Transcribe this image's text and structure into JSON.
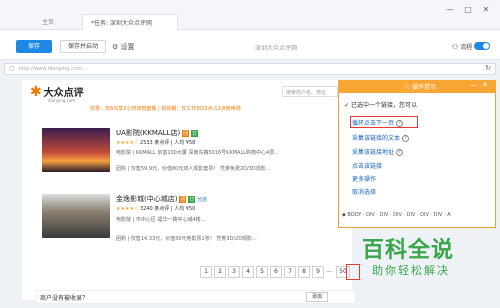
{
  "titlebar": {
    "tabs": [
      {
        "label": "主页"
      },
      {
        "label": "*任务: 深圳大众点评网"
      }
    ],
    "window_controls": [
      "—",
      "□",
      "✕"
    ]
  },
  "toolbar": {
    "save_label": "保存",
    "save_start_label": "保存并启动",
    "settings_label": "设置",
    "task_title": "深圳大众点评网",
    "flow_label": "流程"
  },
  "address_bar": {
    "value": "http://www.dianping.com..."
  },
  "site": {
    "logo_text": "大众点评",
    "logo_url": "dianping.com",
    "search_placeholder": "搜索商户名、地址",
    "top_promo": "优惠：仅6元享2小时双倍套餐 | 有效期：仅工作日10点-12点使用场",
    "listings": [
      {
        "name": "UA影院(KKMALL店)",
        "badges": [
          "团",
          "订"
        ],
        "reviews": "2533 条点评",
        "price": "人均 ¥58",
        "meta": "电影院 | KKMALL 京基100大厦  深南东路5016号KKMALL购物中心4层...",
        "deal": "团购 | 仅售59.9元，价值80元双人观影套票！ 凭券免费2D/3D观影..."
      },
      {
        "name": "金逸影城(中心城店)",
        "badges": [
          "团",
          "订"
        ],
        "branch": "分店",
        "reviews": "3240 条点评",
        "price": "人均 ¥50",
        "meta": "电影院 | 市中心区  福华一路中心城4楼...",
        "deal": "团购 | 仅售14.33元，价值30元电影票1张！ 凭券3D/2D观影..."
      }
    ],
    "pagination": [
      "1",
      "2",
      "3",
      "4",
      "5",
      "6",
      "7",
      "8",
      "9",
      "...",
      "50"
    ],
    "footer_prompt": "商户没有被收录？",
    "footer_button": "添加"
  },
  "panel": {
    "header": "操作提示",
    "selected_text": "已选中一个链接，您可以",
    "options": [
      {
        "label": "循环点击下一页",
        "highlight": true
      },
      {
        "label": "采集该链接的文本",
        "highlight": false
      },
      {
        "label": "采集该链接地址",
        "highlight": false
      },
      {
        "label": "点击该链接",
        "highlight": false
      },
      {
        "label": "更多操作",
        "highlight": false
      },
      {
        "label": "取消选择",
        "highlight": false
      }
    ],
    "breadcrumb": "◆ BODY · DIV · DIV · DIV · DIV · DIV · DIV · A"
  },
  "watermark": {
    "main": "百科全说",
    "sub": "助你轻松解决"
  },
  "colors": {
    "accent_blue": "#1e88e5",
    "panel_orange": "#f7a633",
    "highlight_red": "#e53935",
    "watermark_green": "#3aa64a"
  }
}
